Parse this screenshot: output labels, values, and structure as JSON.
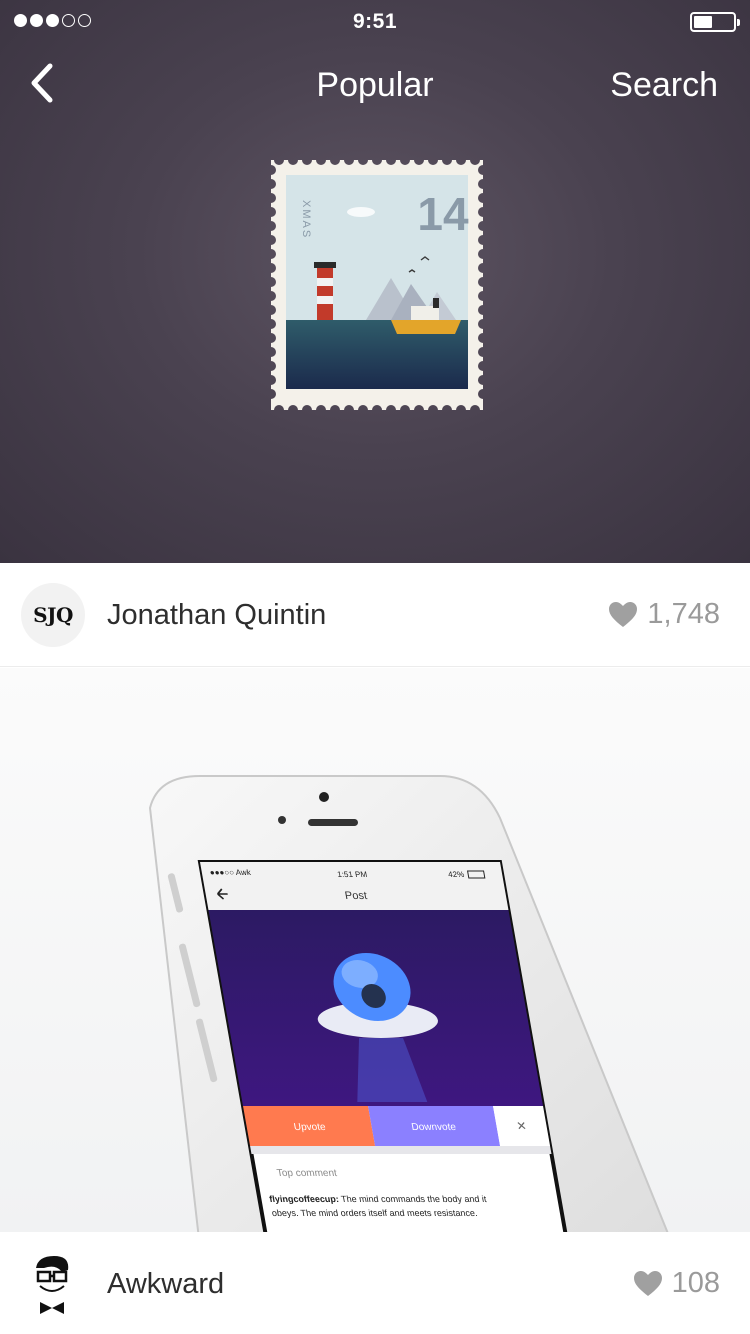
{
  "status_bar": {
    "time": "9:51",
    "signal_bars_filled": 3,
    "signal_bars_total": 5
  },
  "nav": {
    "title": "Popular",
    "search_label": "Search"
  },
  "hero_stamp": {
    "number": "14",
    "label": "XMAS"
  },
  "shots": [
    {
      "author": "Jonathan Quintin",
      "avatar_text": "SJQ",
      "likes": "1,748",
      "preview": {
        "carrier": "●●●○○ Awk",
        "time": "1:51 PM",
        "battery": "42%",
        "screen_title": "Post",
        "upvote_label": "Upvote",
        "downvote_label": "Downvote",
        "close_label": "✕",
        "comment_header": "Top comment",
        "comment_user": "flyingcoffeecup:",
        "comment_line1": " The mind commands the body and it",
        "comment_line2": "obeys. The mind orders itself and meets resistance."
      }
    },
    {
      "author": "Awkward",
      "likes": "108"
    }
  ],
  "colors": {
    "hero_bg": "#4a4250",
    "upvote": "#ff7a4f",
    "downvote": "#8b80ff",
    "post_bg": "#3a1a6b",
    "heart": "#a0a0a0"
  },
  "icons": [
    "chevron-left-icon",
    "heart-icon",
    "battery-icon",
    "wifi-icon"
  ]
}
